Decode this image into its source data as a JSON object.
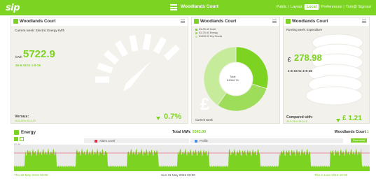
{
  "topbar": {
    "logo": "sip",
    "site_title": "Woodlands Court",
    "nav": [
      "Public",
      "Layout",
      "Local",
      "Preferences",
      "Tom@ Signout"
    ],
    "active_nav": "Local",
    "accent": "#7dd321"
  },
  "panel_electric": {
    "title": "Woodlands Court",
    "subtitle": "Current week: Electric Energy kWh",
    "unit": "kWh",
    "value": "5722.9",
    "date_range": "25-5-15 to 1-6-15",
    "versus_label": "Versus:",
    "versus_range": "18-5-15 to 25-5-15",
    "change": "0.7%"
  },
  "panel_breakdown": {
    "title": "Woodlands Court",
    "legend": [
      "£1176.40 Hotel",
      "£1176.40 Energy",
      "£1590.00 Dry Goods"
    ],
    "center_label": "Total",
    "center_value": "£1944.74",
    "footer": "Current week",
    "currency_glyph": "£",
    "chart_data": {
      "type": "pie",
      "categories": [
        "Hotel",
        "Energy",
        "Dry Goods"
      ],
      "values": [
        1176.4,
        1176.4,
        1590.0
      ]
    }
  },
  "panel_cost": {
    "title": "Woodlands Court",
    "subtitle": "Running week: Expenditure",
    "currency": "£",
    "value": "278.98",
    "date_range": "1-6-15 to 4-6-15",
    "compared_label": "Compared with:",
    "compared_range": "25-5-15 to 28-5-15",
    "change": "£ 1.21"
  },
  "energy": {
    "title": "Energy",
    "total_label": "Total kWh:",
    "total_value": "5343.00",
    "site": "Woodlands Court",
    "site_count": "1",
    "legend_alarm": "Alarm Level",
    "legend_profile": "Profile",
    "download_label": "Download",
    "y_tick": "41.44",
    "footer_left": "Thu 28 May 2015 00:00",
    "footer_mid": "Sun 31 May 2015 00:00",
    "footer_right": "Thu 4 June 2015 10:00",
    "chart_data": {
      "type": "area",
      "series": [
        {
          "name": "Alarm Level"
        },
        {
          "name": "Profile"
        }
      ],
      "x": [
        "Thu 28 May 2015 00:00",
        "Sun 31 May 2015 00:00",
        "Thu 4 June 2015 10:00"
      ]
    }
  }
}
